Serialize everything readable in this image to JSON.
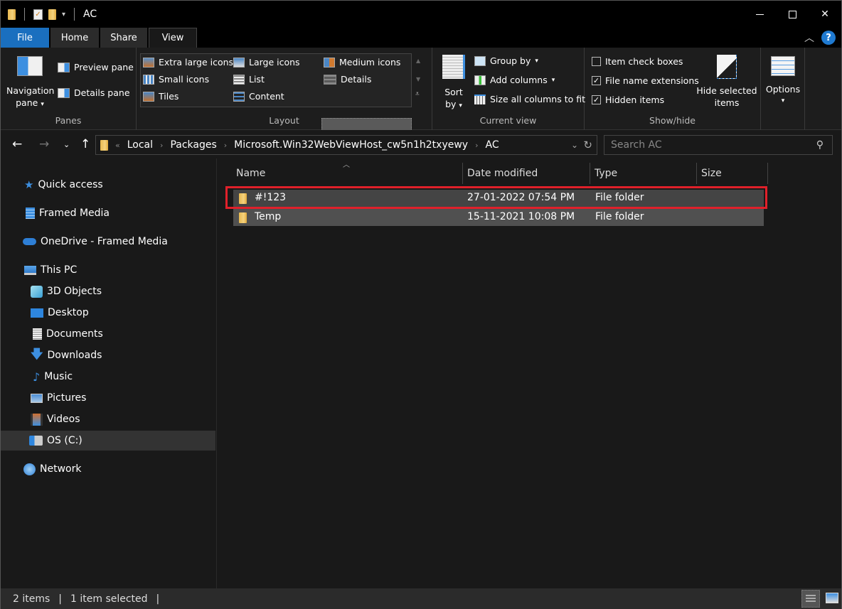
{
  "window": {
    "title": "AC",
    "controls": {
      "minimize": "—",
      "maximize": "☐",
      "close": "✕"
    }
  },
  "quick_access_toolbar": {
    "icons": [
      "folder-icon",
      "properties-icon",
      "new-folder-icon",
      "customize-dropdown-icon"
    ]
  },
  "ribbon_tabs": [
    {
      "label": "File",
      "active": false
    },
    {
      "label": "Home",
      "active": false
    },
    {
      "label": "Share",
      "active": false
    },
    {
      "label": "View",
      "active": true
    }
  ],
  "ribbon": {
    "panes": {
      "label": "Panes",
      "navigation_pane": "Navigation",
      "navigation_pane_2": "pane",
      "preview_pane": "Preview pane",
      "details_pane": "Details pane"
    },
    "layout": {
      "label": "Layout",
      "items": [
        "Extra large icons",
        "Large icons",
        "Medium icons",
        "Small icons",
        "List",
        "Details",
        "Tiles",
        "Content"
      ],
      "selected": "Details"
    },
    "current_view": {
      "label": "Current view",
      "sort_by": "Sort",
      "sort_by_2": "by",
      "group_by": "Group by",
      "add_columns": "Add columns",
      "size_all": "Size all columns to fit"
    },
    "show_hide": {
      "label": "Show/hide",
      "item_check_boxes": {
        "label": "Item check boxes",
        "checked": false
      },
      "file_name_extensions": {
        "label": "File name extensions",
        "checked": true
      },
      "hidden_items": {
        "label": "Hidden items",
        "checked": true
      },
      "hide_selected": "Hide selected",
      "hide_selected_2": "items"
    },
    "options": {
      "label": "Options"
    }
  },
  "address_bar": {
    "overflow": "«",
    "crumbs": [
      "Local",
      "Packages",
      "Microsoft.Win32WebViewHost_cw5n1h2txyewy",
      "AC"
    ]
  },
  "search": {
    "placeholder": "Search AC"
  },
  "sidebar": {
    "items": [
      {
        "label": "Quick access",
        "icon": "star-icon"
      },
      {
        "label": "Framed Media",
        "icon": "building-icon"
      },
      {
        "label": "OneDrive - Framed Media",
        "icon": "cloud-icon"
      },
      {
        "label": "This PC",
        "icon": "computer-icon"
      },
      {
        "label": "3D Objects",
        "icon": "cube-icon"
      },
      {
        "label": "Desktop",
        "icon": "desktop-icon"
      },
      {
        "label": "Documents",
        "icon": "document-icon"
      },
      {
        "label": "Downloads",
        "icon": "download-icon"
      },
      {
        "label": "Music",
        "icon": "music-icon"
      },
      {
        "label": "Pictures",
        "icon": "pictures-icon"
      },
      {
        "label": "Videos",
        "icon": "videos-icon"
      },
      {
        "label": "OS (C:)",
        "icon": "drive-icon",
        "selected": true
      },
      {
        "label": "Network",
        "icon": "network-icon"
      }
    ]
  },
  "file_list": {
    "columns": [
      "Name",
      "Date modified",
      "Type",
      "Size"
    ],
    "rows": [
      {
        "name": "#!123",
        "date": "27-01-2022 07:54 PM",
        "type": "File folder",
        "size": "",
        "selected": true
      },
      {
        "name": "Temp",
        "date": "15-11-2021 10:08 PM",
        "type": "File folder",
        "size": "",
        "selected": false
      }
    ]
  },
  "status_bar": {
    "item_count": "2 items",
    "selection": "1 item selected"
  },
  "colors": {
    "file_tab": "#1a6fbf",
    "highlight_box": "#e0202a",
    "help": "#1f7ad1"
  }
}
